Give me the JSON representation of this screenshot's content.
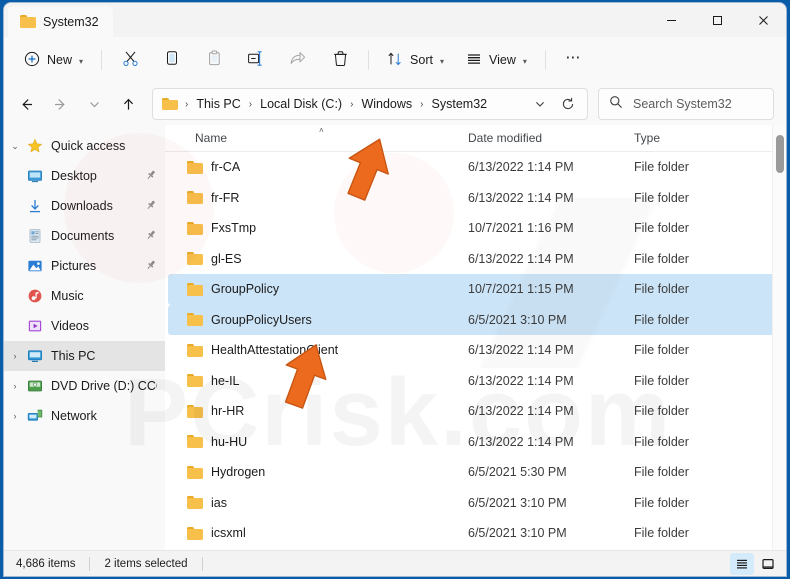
{
  "window": {
    "tab_title": "System32",
    "minimize_label": "Minimize",
    "maximize_label": "Maximize",
    "close_label": "Close"
  },
  "toolbar": {
    "new_label": "New",
    "cut_label": "Cut",
    "copy_label": "Copy",
    "paste_label": "Paste",
    "rename_label": "Rename",
    "share_label": "Share",
    "delete_label": "Delete",
    "sort_label": "Sort",
    "view_label": "View",
    "more_label": "See more"
  },
  "address": {
    "back_label": "Back",
    "forward_label": "Forward",
    "recent_label": "Recent locations",
    "up_label": "Up",
    "crumbs": [
      "This PC",
      "Local Disk (C:)",
      "Windows",
      "System32"
    ],
    "separator": "›",
    "refresh_label": "Refresh",
    "dropdown_label": "Previous locations"
  },
  "search": {
    "placeholder": "Search System32",
    "value": ""
  },
  "sidebar": {
    "items": [
      {
        "label": "Quick access",
        "icon": "star-icon",
        "twisty": "⌄",
        "indent": false,
        "pinned": false,
        "selected": false
      },
      {
        "label": "Desktop",
        "icon": "desktop-icon",
        "twisty": "",
        "indent": true,
        "pinned": true,
        "selected": false
      },
      {
        "label": "Downloads",
        "icon": "download-icon",
        "twisty": "",
        "indent": true,
        "pinned": true,
        "selected": false
      },
      {
        "label": "Documents",
        "icon": "document-icon",
        "twisty": "",
        "indent": true,
        "pinned": true,
        "selected": false
      },
      {
        "label": "Pictures",
        "icon": "pictures-icon",
        "twisty": "",
        "indent": true,
        "pinned": true,
        "selected": false
      },
      {
        "label": "Music",
        "icon": "music-icon",
        "twisty": "",
        "indent": true,
        "pinned": false,
        "selected": false
      },
      {
        "label": "Videos",
        "icon": "video-icon",
        "twisty": "",
        "indent": true,
        "pinned": false,
        "selected": false
      },
      {
        "label": "This PC",
        "icon": "pc-icon",
        "twisty": "›",
        "indent": false,
        "pinned": false,
        "selected": true
      },
      {
        "label": "DVD Drive (D:) CCCC",
        "icon": "dvd-icon",
        "twisty": "›",
        "indent": false,
        "pinned": false,
        "selected": false
      },
      {
        "label": "Network",
        "icon": "network-icon",
        "twisty": "›",
        "indent": false,
        "pinned": false,
        "selected": false
      }
    ]
  },
  "filelist": {
    "columns": {
      "name": "Name",
      "date_modified": "Date modified",
      "type": "Type"
    },
    "sort_indicator": "˄",
    "rows": [
      {
        "name": "fr-CA",
        "date": "6/13/2022 1:14 PM",
        "type": "File folder",
        "selected": false
      },
      {
        "name": "fr-FR",
        "date": "6/13/2022 1:14 PM",
        "type": "File folder",
        "selected": false
      },
      {
        "name": "FxsTmp",
        "date": "10/7/2021 1:16 PM",
        "type": "File folder",
        "selected": false
      },
      {
        "name": "gl-ES",
        "date": "6/13/2022 1:14 PM",
        "type": "File folder",
        "selected": false
      },
      {
        "name": "GroupPolicy",
        "date": "10/7/2021 1:15 PM",
        "type": "File folder",
        "selected": true
      },
      {
        "name": "GroupPolicyUsers",
        "date": "6/5/2021 3:10 PM",
        "type": "File folder",
        "selected": true
      },
      {
        "name": "HealthAttestationClient",
        "date": "6/13/2022 1:14 PM",
        "type": "File folder",
        "selected": false
      },
      {
        "name": "he-IL",
        "date": "6/13/2022 1:14 PM",
        "type": "File folder",
        "selected": false
      },
      {
        "name": "hr-HR",
        "date": "6/13/2022 1:14 PM",
        "type": "File folder",
        "selected": false
      },
      {
        "name": "hu-HU",
        "date": "6/13/2022 1:14 PM",
        "type": "File folder",
        "selected": false
      },
      {
        "name": "Hydrogen",
        "date": "6/5/2021 5:30 PM",
        "type": "File folder",
        "selected": false
      },
      {
        "name": "ias",
        "date": "6/5/2021 3:10 PM",
        "type": "File folder",
        "selected": false
      },
      {
        "name": "icsxml",
        "date": "6/5/2021 3:10 PM",
        "type": "File folder",
        "selected": false
      }
    ]
  },
  "statusbar": {
    "item_count": "4,686 items",
    "selection_count": "2 items selected",
    "details_view_label": "Details view",
    "large_icons_view_label": "Large icons view"
  },
  "colors": {
    "accent": "#0b5ca8",
    "selection": "#cce4f7",
    "folder": "#f7c04a",
    "arrow": "#ec6a1e"
  },
  "watermark": {
    "text": "PCrisk.com"
  }
}
